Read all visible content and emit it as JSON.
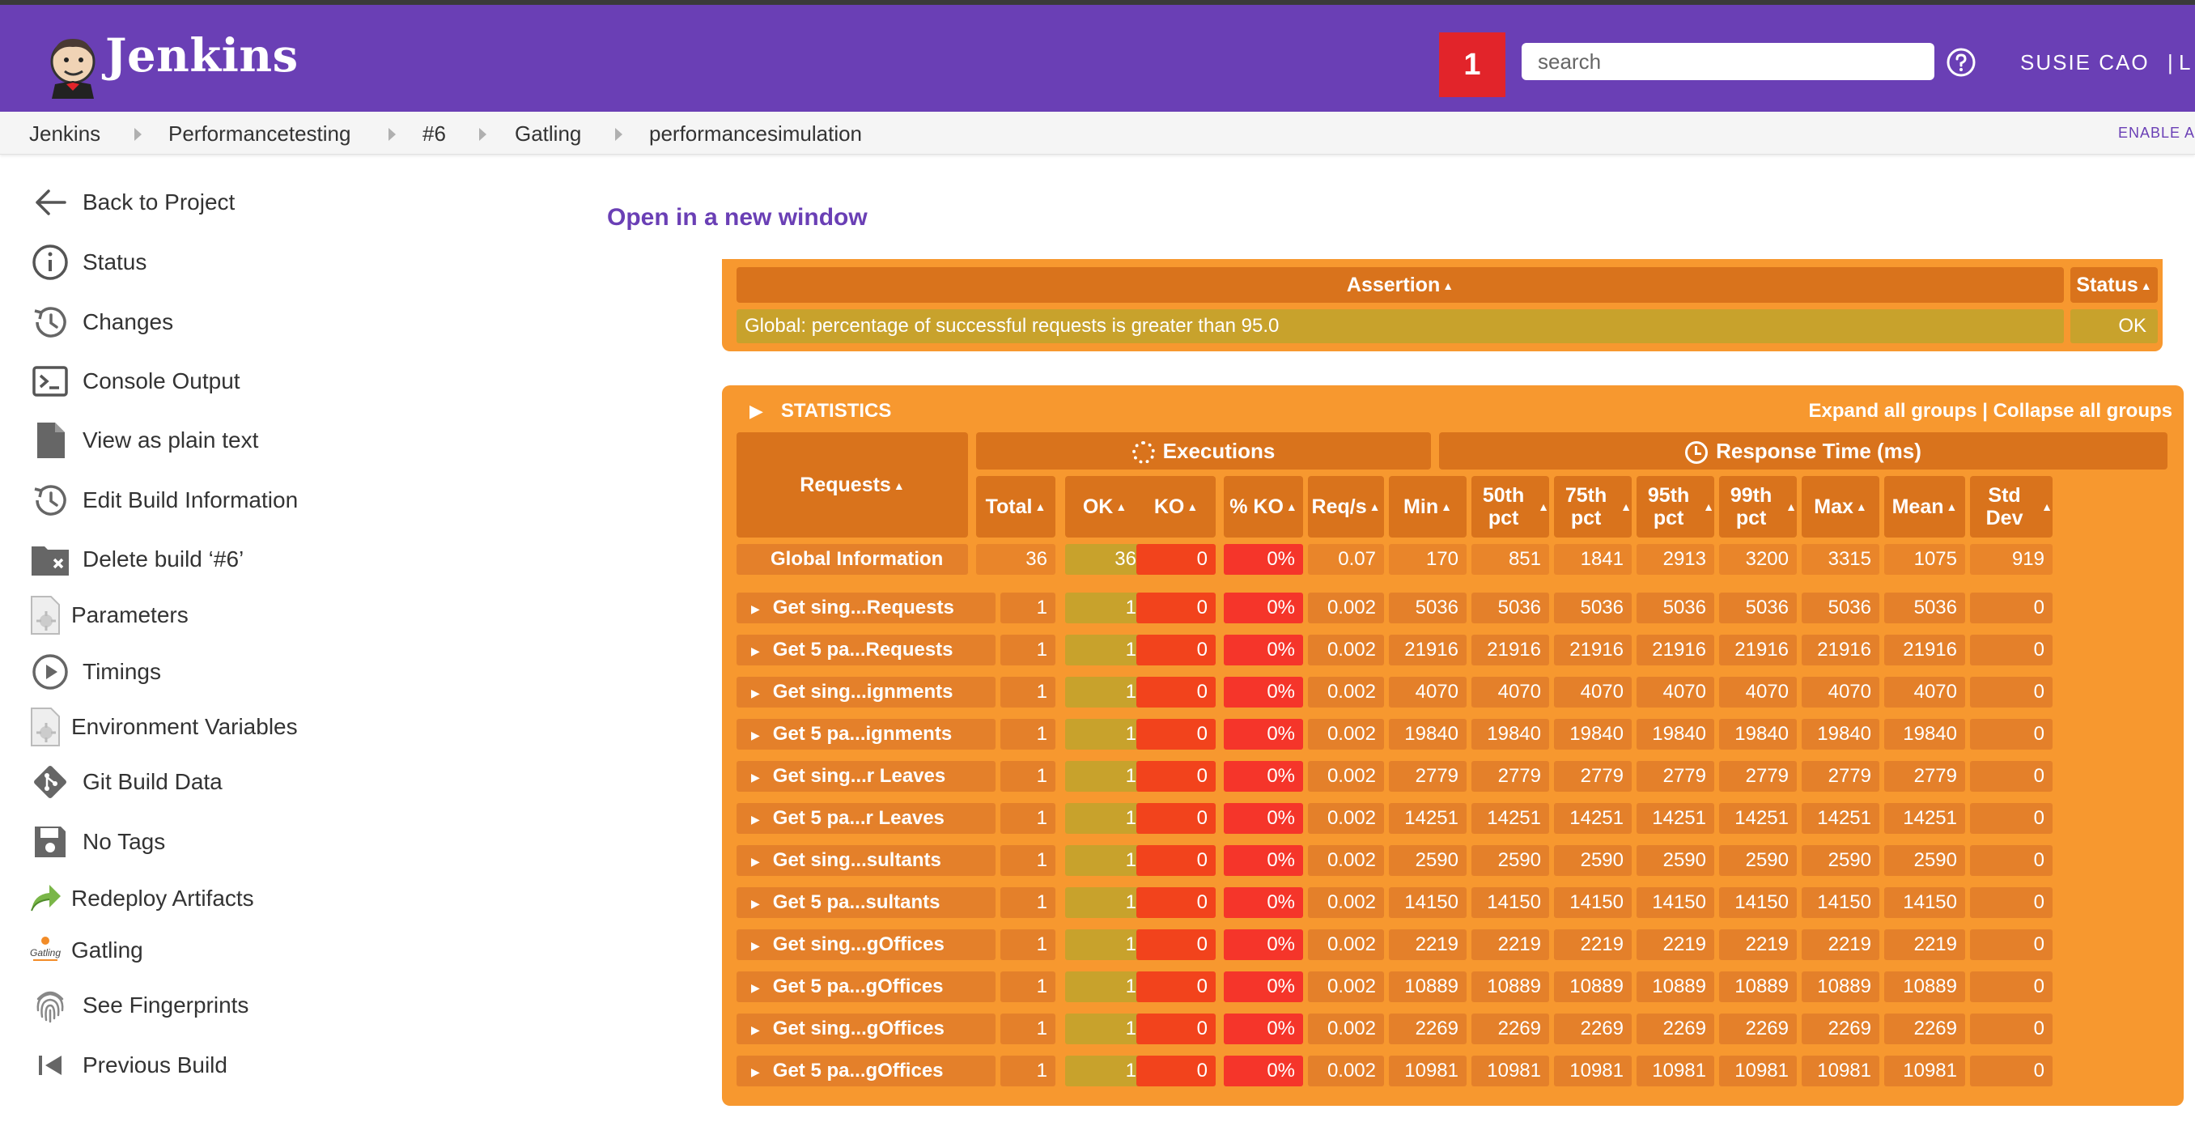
{
  "header": {
    "brand": "Jenkins",
    "notification_count": "1",
    "search_placeholder": "search",
    "user": "SUSIE CAO",
    "logout": "| L"
  },
  "breadcrumb": [
    "Jenkins",
    "Performancetesting",
    "#6",
    "Gatling",
    "performancesimulation"
  ],
  "breadcrumb_right": "ENABLE A",
  "sidebar": [
    {
      "label": "Back to Project",
      "icon": "arrow-left-icon"
    },
    {
      "label": "Status",
      "icon": "info-icon"
    },
    {
      "label": "Changes",
      "icon": "history-icon"
    },
    {
      "label": "Console Output",
      "icon": "terminal-icon"
    },
    {
      "label": "View as plain text",
      "icon": "document-icon"
    },
    {
      "label": "Edit Build Information",
      "icon": "history-icon"
    },
    {
      "label": "Delete build ‘#6’",
      "icon": "folder-delete-icon"
    },
    {
      "label": "Parameters",
      "icon": "parameters-icon"
    },
    {
      "label": "Timings",
      "icon": "play-circle-icon"
    },
    {
      "label": "Environment Variables",
      "icon": "parameters-icon"
    },
    {
      "label": "Git Build Data",
      "icon": "git-icon"
    },
    {
      "label": "No Tags",
      "icon": "save-icon"
    },
    {
      "label": "Redeploy Artifacts",
      "icon": "redeploy-icon"
    },
    {
      "label": "Gatling",
      "icon": "gatling-icon"
    },
    {
      "label": "See Fingerprints",
      "icon": "fingerprint-icon"
    },
    {
      "label": "Previous Build",
      "icon": "previous-icon"
    }
  ],
  "main": {
    "open_link": "Open in a new window",
    "assertions": {
      "col_assertion": "Assertion",
      "col_status": "Status",
      "row": {
        "text": "Global: percentage of successful requests is greater than 95.0",
        "status": "OK"
      }
    },
    "statistics": {
      "title": "STATISTICS",
      "expand_all": "Expand all groups",
      "separator": "|",
      "collapse_all": "Collapse all groups",
      "requests_label": "Requests",
      "executions_label": "Executions",
      "response_time_label": "Response Time (ms)",
      "columns": [
        "Total",
        "OK",
        "KO",
        "% KO",
        "Req/s",
        "Min",
        "50th pct",
        "75th pct",
        "95th pct",
        "99th pct",
        "Max",
        "Mean",
        "Std Dev"
      ],
      "global": {
        "name": "Global Information",
        "values": [
          "36",
          "36",
          "0",
          "0%",
          "0.07",
          "170",
          "851",
          "1841",
          "2913",
          "3200",
          "3315",
          "1075",
          "919"
        ]
      },
      "rows": [
        {
          "name": "Get sing...Requests",
          "values": [
            "1",
            "1",
            "0",
            "0%",
            "0.002",
            "5036",
            "5036",
            "5036",
            "5036",
            "5036",
            "5036",
            "5036",
            "0"
          ]
        },
        {
          "name": "Get 5 pa...Requests",
          "values": [
            "1",
            "1",
            "0",
            "0%",
            "0.002",
            "21916",
            "21916",
            "21916",
            "21916",
            "21916",
            "21916",
            "21916",
            "0"
          ]
        },
        {
          "name": "Get sing...ignments",
          "values": [
            "1",
            "1",
            "0",
            "0%",
            "0.002",
            "4070",
            "4070",
            "4070",
            "4070",
            "4070",
            "4070",
            "4070",
            "0"
          ]
        },
        {
          "name": "Get 5 pa...ignments",
          "values": [
            "1",
            "1",
            "0",
            "0%",
            "0.002",
            "19840",
            "19840",
            "19840",
            "19840",
            "19840",
            "19840",
            "19840",
            "0"
          ]
        },
        {
          "name": "Get sing...r Leaves",
          "values": [
            "1",
            "1",
            "0",
            "0%",
            "0.002",
            "2779",
            "2779",
            "2779",
            "2779",
            "2779",
            "2779",
            "2779",
            "0"
          ]
        },
        {
          "name": "Get 5 pa...r Leaves",
          "values": [
            "1",
            "1",
            "0",
            "0%",
            "0.002",
            "14251",
            "14251",
            "14251",
            "14251",
            "14251",
            "14251",
            "14251",
            "0"
          ]
        },
        {
          "name": "Get sing...sultants",
          "values": [
            "1",
            "1",
            "0",
            "0%",
            "0.002",
            "2590",
            "2590",
            "2590",
            "2590",
            "2590",
            "2590",
            "2590",
            "0"
          ]
        },
        {
          "name": "Get 5 pa...sultants",
          "values": [
            "1",
            "1",
            "0",
            "0%",
            "0.002",
            "14150",
            "14150",
            "14150",
            "14150",
            "14150",
            "14150",
            "14150",
            "0"
          ]
        },
        {
          "name": "Get sing...gOffices",
          "values": [
            "1",
            "1",
            "0",
            "0%",
            "0.002",
            "2219",
            "2219",
            "2219",
            "2219",
            "2219",
            "2219",
            "2219",
            "0"
          ]
        },
        {
          "name": "Get 5 pa...gOffices",
          "values": [
            "1",
            "1",
            "0",
            "0%",
            "0.002",
            "10889",
            "10889",
            "10889",
            "10889",
            "10889",
            "10889",
            "10889",
            "0"
          ]
        },
        {
          "name": "Get sing...gOffices",
          "values": [
            "1",
            "1",
            "0",
            "0%",
            "0.002",
            "2269",
            "2269",
            "2269",
            "2269",
            "2269",
            "2269",
            "2269",
            "0"
          ]
        },
        {
          "name": "Get 5 pa...gOffices",
          "values": [
            "1",
            "1",
            "0",
            "0%",
            "0.002",
            "10981",
            "10981",
            "10981",
            "10981",
            "10981",
            "10981",
            "10981",
            "0"
          ]
        }
      ]
    }
  },
  "colors": {
    "header_bg": "#6a3fb5",
    "panel_orange": "#f7982f",
    "header_cell": "#d9731c",
    "ok_cell": "#c8a22c",
    "ko_cell": "#f2431c",
    "pct_ko_cell": "#f5352a",
    "notif_red": "#e2242a"
  }
}
